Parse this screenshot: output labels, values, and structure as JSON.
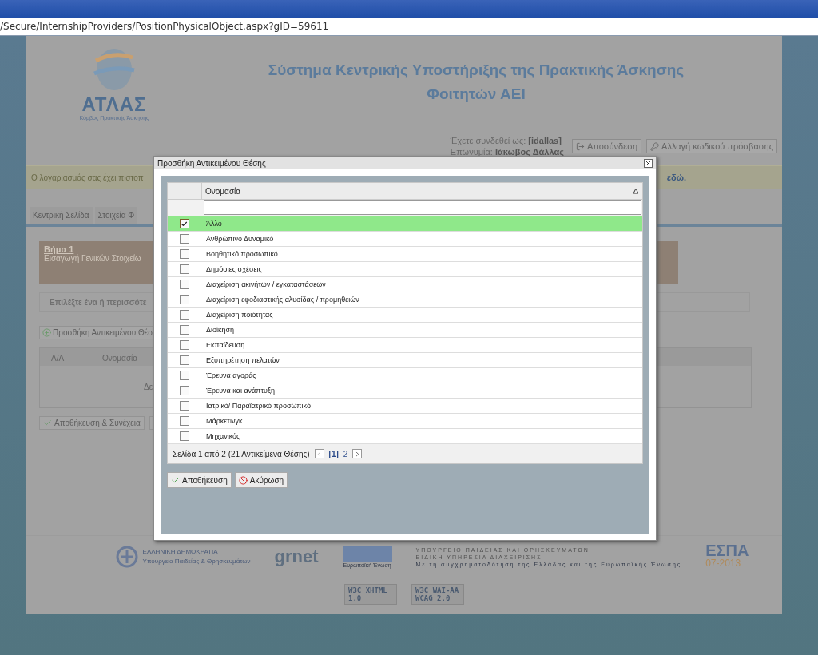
{
  "browser": {
    "url": "/Secure/InternshipProviders/PositionPhysicalObject.aspx?gID=59611"
  },
  "header": {
    "logo_text": "ΑΤΛΑΣ",
    "logo_subtitle": "Κόμβος Πρακτικής Άσκησης",
    "title_lines": [
      "Σύστημα Κεντρικής Υποστήριξης της Πρακτικής Άσκησης",
      "Φοιτητών ΑΕΙ"
    ]
  },
  "user": {
    "login_label": "Έχετε συνδεθεί ως:",
    "login_value": "[idallas]",
    "name_label": "Επωνυμία:",
    "name_value": "Ιάκωβος Δάλλας",
    "buttons": [
      {
        "label": "Αποσύνδεση",
        "kind": "logout"
      },
      {
        "label": "Αλλαγή κωδικού πρόσβασης",
        "kind": "password"
      }
    ]
  },
  "notice": {
    "text": "Ο λογαριασμός σας έχει πιστοπ",
    "link": "εδώ."
  },
  "tabs": [
    "Κεντρική Σελίδα",
    "Στοιχεία Φ"
  ],
  "step": {
    "title": "Βήμα 1",
    "subtitle": "Εισαγωγή Γενικών Στοιχείω"
  },
  "instruction": "Επιλέξτε ένα ή περισσότε",
  "add_button": "Προσθήκη Αντικειμένου Θέσ",
  "table": {
    "columns": [
      "Α/Α",
      "Ονομασία"
    ],
    "empty": "Δε"
  },
  "save_button": "Αποθήκευση & Συνέχεια",
  "footer": {
    "gov_lines": [
      "ΕΛΛΗΝΙΚΗ ΔΗΜΟΚΡΑΤΙΑ",
      "Υπουργείο Παιδείας & Θρησκευμάτων"
    ],
    "grnet": "grnet",
    "eu": "Ευρωπαϊκή Ένωση",
    "ministry_lines": [
      "ΥΠΟΥΡΓΕΙΟ ΠΑΙΔΕΙΑΣ ΚΑΙ ΘΡΗΣΚΕΥΜΑΤΩΝ",
      "ΕΙΔΙΚΗ ΥΠΗΡΕΣΙΑ ΔΙΑΧΕΙΡΙΣΗΣ"
    ],
    "cofunding": "Με τη συγχρηματοδότηση της Ελλάδας και της Ευρωπαϊκής Ένωσης",
    "espa": "ΕΣΠΑ",
    "espa_years": "07-2013",
    "badges": [
      {
        "mark": "W3C",
        "text": "XHTML 1.0"
      },
      {
        "mark": "W3C",
        "text": "WAI-AA WCAG 2.0"
      }
    ]
  },
  "dialog": {
    "title": "Προσθήκη Αντικειμένου Θέσης",
    "column": "Ονομασία",
    "rows": [
      {
        "label": "Άλλο",
        "checked": true
      },
      {
        "label": "Ανθρώπινο Δυναμικό",
        "checked": false
      },
      {
        "label": "Βοηθητικό προσωπικό",
        "checked": false
      },
      {
        "label": "Δημόσιες σχέσεις",
        "checked": false
      },
      {
        "label": "Διαχείριση ακινήτων / εγκαταστάσεων",
        "checked": false
      },
      {
        "label": "Διαχείριση εφοδιαστικής αλυσίδας / προμηθειών",
        "checked": false
      },
      {
        "label": "Διαχείριση ποιότητας",
        "checked": false
      },
      {
        "label": "Διοίκηση",
        "checked": false
      },
      {
        "label": "Εκπαίδευση",
        "checked": false
      },
      {
        "label": "Εξυπηρέτηση πελατών",
        "checked": false
      },
      {
        "label": "Έρευνα αγοράς",
        "checked": false
      },
      {
        "label": "Έρευνα και ανάπτυξη",
        "checked": false
      },
      {
        "label": "Ιατρικό/ Παραϊατρικό προσωπικό",
        "checked": false
      },
      {
        "label": "Μάρκετινγκ",
        "checked": false
      },
      {
        "label": "Μηχανικός",
        "checked": false
      }
    ],
    "pager": {
      "summary": "Σελίδα 1 από 2 (21 Αντικείμενα Θέσης)",
      "pages": [
        {
          "label": "[1]",
          "selected": true
        },
        {
          "label": "2",
          "selected": false
        }
      ]
    },
    "buttons": [
      {
        "label": "Αποθήκευση",
        "kind": "save"
      },
      {
        "label": "Ακύρωση",
        "kind": "cancel"
      }
    ]
  }
}
